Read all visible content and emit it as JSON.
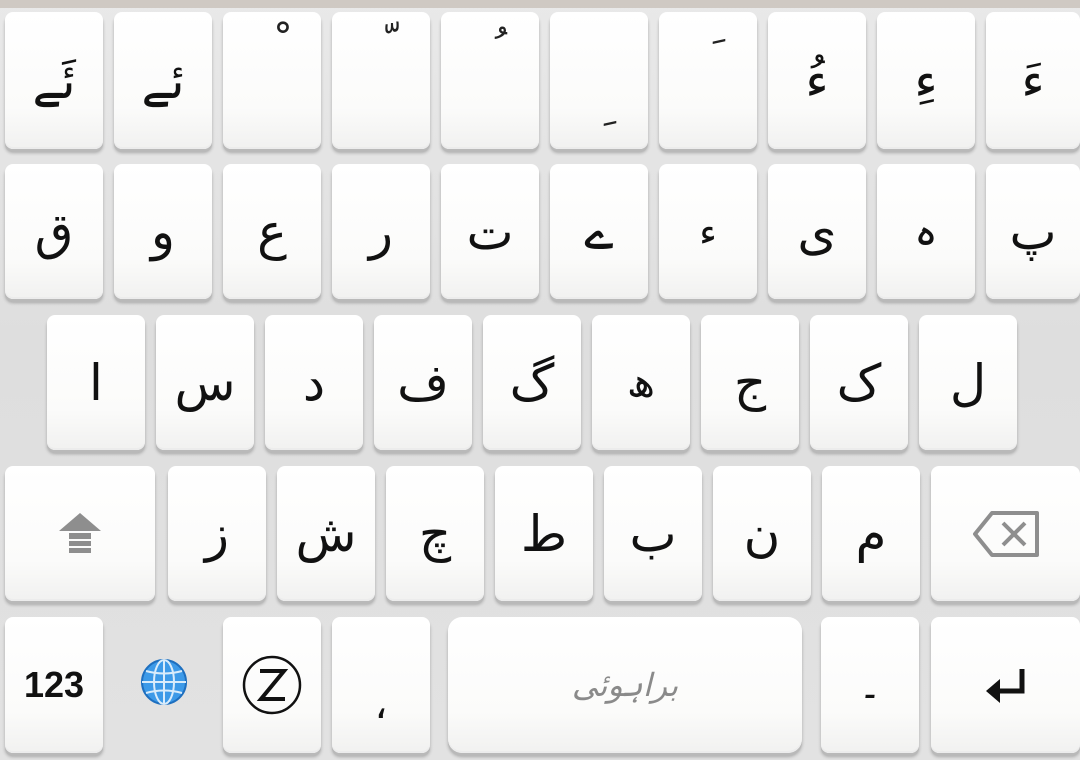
{
  "keyboard": {
    "row1": [
      "ئَے",
      "ئے",
      "ْ",
      "ّ",
      "ُ",
      "ِ",
      "َ",
      "ءُ",
      "ءِ",
      "ءَ"
    ],
    "row2": [
      "ق",
      "و",
      "ع",
      "ر",
      "ت",
      "ے",
      "ء",
      "ی",
      "ہ",
      "پ"
    ],
    "row3": [
      "ا",
      "س",
      "د",
      "ف",
      "گ",
      "ھ",
      "ج",
      "ک",
      "ل"
    ],
    "row4": [
      "ز",
      "ش",
      "چ",
      "ط",
      "ب",
      "ن",
      "م"
    ],
    "bottom": {
      "numbers_label": "123",
      "comma": "،",
      "space_label": "براہوئی",
      "period": "۔"
    }
  },
  "icons": {
    "shift": "shift-icon",
    "backspace": "backspace-icon",
    "globe": "globe-icon",
    "z_logo": "z-logo-icon",
    "enter": "enter-icon"
  },
  "colors": {
    "key_face": "#ffffff",
    "background": "#e4e4e4",
    "globe_blue": "#2f8fe0",
    "space_label": "#8a8a8a"
  }
}
